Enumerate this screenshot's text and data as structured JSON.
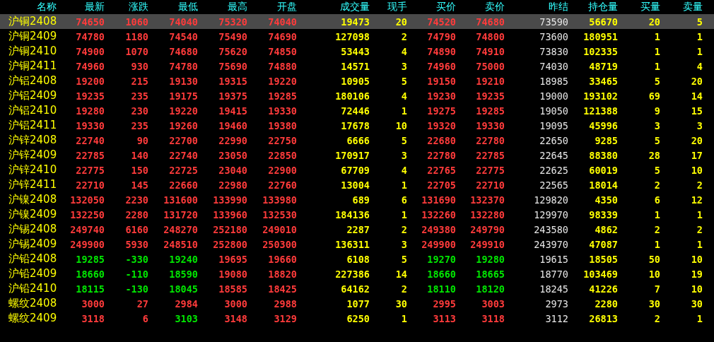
{
  "columns": [
    {
      "label": "名称",
      "kind": "name"
    },
    {
      "label": "最新",
      "kind": "price"
    },
    {
      "label": "涨跌",
      "kind": "change"
    },
    {
      "label": "最低",
      "kind": "price"
    },
    {
      "label": "最高",
      "kind": "price"
    },
    {
      "label": "开盘",
      "kind": "price"
    },
    {
      "label": "成交量",
      "kind": "volume"
    },
    {
      "label": "现手",
      "kind": "volume"
    },
    {
      "label": "买价",
      "kind": "price"
    },
    {
      "label": "卖价",
      "kind": "price"
    },
    {
      "label": "昨结",
      "kind": "prev_close"
    },
    {
      "label": "持仓量",
      "kind": "volume"
    },
    {
      "label": "买量",
      "kind": "volume"
    },
    {
      "label": "卖量",
      "kind": "volume"
    }
  ],
  "rows": [
    {
      "selected": true,
      "cells": [
        "沪铜2408",
        "74650",
        "1060",
        "74040",
        "75320",
        "74040",
        "19473",
        "20",
        "74520",
        "74680",
        "73590",
        "56670",
        "20",
        "5"
      ]
    },
    {
      "selected": false,
      "cells": [
        "沪铜2409",
        "74780",
        "1180",
        "74540",
        "75490",
        "74690",
        "127098",
        "2",
        "74790",
        "74800",
        "73600",
        "180951",
        "1",
        "1"
      ]
    },
    {
      "selected": false,
      "cells": [
        "沪铜2410",
        "74900",
        "1070",
        "74680",
        "75620",
        "74850",
        "53443",
        "4",
        "74890",
        "74910",
        "73830",
        "102335",
        "1",
        "1"
      ]
    },
    {
      "selected": false,
      "cells": [
        "沪铜2411",
        "74960",
        "930",
        "74780",
        "75690",
        "74880",
        "14571",
        "3",
        "74960",
        "75000",
        "74030",
        "48719",
        "1",
        "4"
      ]
    },
    {
      "selected": false,
      "cells": [
        "沪铝2408",
        "19200",
        "215",
        "19130",
        "19315",
        "19220",
        "10905",
        "5",
        "19150",
        "19210",
        "18985",
        "33465",
        "5",
        "20"
      ]
    },
    {
      "selected": false,
      "cells": [
        "沪铝2409",
        "19235",
        "235",
        "19175",
        "19375",
        "19285",
        "180106",
        "4",
        "19230",
        "19235",
        "19000",
        "193102",
        "69",
        "14"
      ]
    },
    {
      "selected": false,
      "cells": [
        "沪铝2410",
        "19280",
        "230",
        "19220",
        "19415",
        "19330",
        "72446",
        "1",
        "19275",
        "19285",
        "19050",
        "121388",
        "9",
        "15"
      ]
    },
    {
      "selected": false,
      "cells": [
        "沪铝2411",
        "19330",
        "235",
        "19260",
        "19460",
        "19380",
        "17678",
        "10",
        "19320",
        "19330",
        "19095",
        "45996",
        "3",
        "3"
      ]
    },
    {
      "selected": false,
      "cells": [
        "沪锌2408",
        "22740",
        "90",
        "22700",
        "22990",
        "22750",
        "6666",
        "5",
        "22680",
        "22780",
        "22650",
        "9285",
        "5",
        "20"
      ]
    },
    {
      "selected": false,
      "cells": [
        "沪锌2409",
        "22785",
        "140",
        "22740",
        "23050",
        "22850",
        "170917",
        "3",
        "22780",
        "22785",
        "22645",
        "88380",
        "28",
        "17"
      ]
    },
    {
      "selected": false,
      "cells": [
        "沪锌2410",
        "22775",
        "150",
        "22725",
        "23040",
        "22900",
        "67709",
        "4",
        "22765",
        "22775",
        "22625",
        "60019",
        "5",
        "10"
      ]
    },
    {
      "selected": false,
      "cells": [
        "沪锌2411",
        "22710",
        "145",
        "22660",
        "22980",
        "22760",
        "13004",
        "1",
        "22705",
        "22710",
        "22565",
        "18014",
        "2",
        "2"
      ]
    },
    {
      "selected": false,
      "cells": [
        "沪镍2408",
        "132050",
        "2230",
        "131600",
        "133990",
        "133980",
        "689",
        "6",
        "131690",
        "132370",
        "129820",
        "4350",
        "6",
        "12"
      ]
    },
    {
      "selected": false,
      "cells": [
        "沪镍2409",
        "132250",
        "2280",
        "131720",
        "133960",
        "132530",
        "184136",
        "1",
        "132260",
        "132280",
        "129970",
        "98339",
        "1",
        "1"
      ]
    },
    {
      "selected": false,
      "cells": [
        "沪锡2408",
        "249740",
        "6160",
        "248270",
        "252180",
        "249010",
        "2287",
        "2",
        "249380",
        "249790",
        "243580",
        "4862",
        "2",
        "2"
      ]
    },
    {
      "selected": false,
      "cells": [
        "沪锡2409",
        "249900",
        "5930",
        "248510",
        "252800",
        "250300",
        "136311",
        "3",
        "249900",
        "249910",
        "243970",
        "47087",
        "1",
        "1"
      ]
    },
    {
      "selected": false,
      "cells": [
        "沪铅2408",
        "19285",
        "-330",
        "19240",
        "19695",
        "19660",
        "6108",
        "5",
        "19270",
        "19280",
        "19615",
        "18505",
        "50",
        "10"
      ]
    },
    {
      "selected": false,
      "cells": [
        "沪铅2409",
        "18660",
        "-110",
        "18590",
        "19080",
        "18820",
        "227386",
        "14",
        "18660",
        "18665",
        "18770",
        "103469",
        "10",
        "19"
      ]
    },
    {
      "selected": false,
      "cells": [
        "沪铅2410",
        "18115",
        "-130",
        "18045",
        "18585",
        "18425",
        "64162",
        "2",
        "18110",
        "18120",
        "18245",
        "41226",
        "7",
        "10"
      ]
    },
    {
      "selected": false,
      "cells": [
        "螺纹2408",
        "3000",
        "27",
        "2984",
        "3000",
        "2988",
        "1077",
        "30",
        "2995",
        "3003",
        "2973",
        "2280",
        "30",
        "30"
      ]
    },
    {
      "selected": false,
      "cells": [
        "螺纹2409",
        "3118",
        "6",
        "3103",
        "3148",
        "3129",
        "6250",
        "1",
        "3113",
        "3118",
        "3112",
        "26813",
        "2",
        "1"
      ]
    }
  ]
}
